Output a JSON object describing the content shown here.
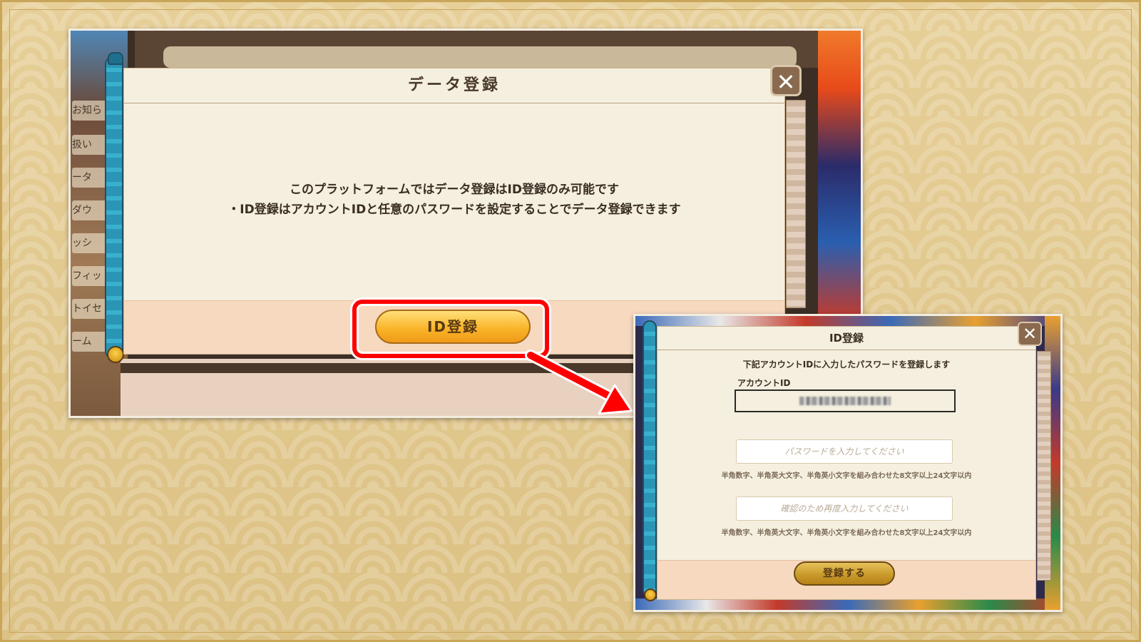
{
  "dialog1": {
    "title": "データ登録",
    "message_line1": "このプラットフォームではデータ登録はID登録のみ可能です",
    "message_line2": "・ID登録はアカウントIDと任意のパスワードを設定することでデータ登録できます",
    "close_label": "✕",
    "id_button_label": "ID登録",
    "background_menu": [
      "お知ら",
      "扱い",
      "ータ",
      "ダウ",
      "ッシ",
      "フィッ",
      "トイセ",
      "ーム"
    ]
  },
  "dialog2": {
    "title": "ID登録",
    "description": "下記アカウントIDに入力したパスワードを登録します",
    "account_id_label": "アカウントID",
    "password_placeholder": "パスワードを入力してください",
    "password_hint": "半角数字、半角英大文字、半角英小文字を組み合わせた8文字以上24文字以内",
    "confirm_placeholder": "確認のため再度入力してください",
    "confirm_hint": "半角数字、半角英大文字、半角英小文字を組み合わせた8文字以上24文字以内",
    "register_button_label": "登録する",
    "close_label": "✕"
  },
  "colors": {
    "highlight": "#ff0000",
    "arrow": "#ff0000",
    "primary_button": "#f9b52a",
    "panel": "#f5efdf",
    "footer": "#f6d9bf"
  }
}
